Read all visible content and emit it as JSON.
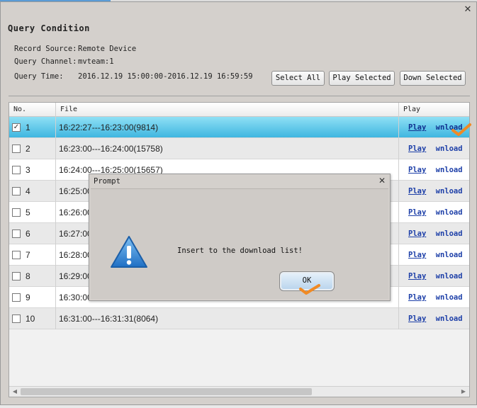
{
  "window": {
    "close_icon": "close-icon"
  },
  "query": {
    "title": "Query Condition",
    "record_source_label": "Record Source:",
    "record_source_value": "Remote Device",
    "channel_label": "Query Channel:",
    "channel_value": "mvteam:1",
    "time_label": "Query Time:",
    "time_value": "2016.12.19 15:00:00-2016.12.19 16:59:59"
  },
  "buttons": {
    "select_all": "Select All",
    "play_selected": "Play Selected",
    "down_selected": "Down Selected"
  },
  "table": {
    "columns": [
      "No.",
      "File",
      "Play"
    ],
    "play_link": "Play",
    "download_link": "Download",
    "rows": [
      {
        "no": "1",
        "file": "16:22:27---16:23:00(9814)",
        "checked": true,
        "selected": true
      },
      {
        "no": "2",
        "file": "16:23:00---16:24:00(15758)",
        "checked": false,
        "selected": false
      },
      {
        "no": "3",
        "file": "16:24:00---16:25:00(15657)",
        "checked": false,
        "selected": false
      },
      {
        "no": "4",
        "file": "16:25:00",
        "checked": false,
        "selected": false
      },
      {
        "no": "5",
        "file": "16:26:00",
        "checked": false,
        "selected": false
      },
      {
        "no": "6",
        "file": "16:27:00",
        "checked": false,
        "selected": false
      },
      {
        "no": "7",
        "file": "16:28:00",
        "checked": false,
        "selected": false
      },
      {
        "no": "8",
        "file": "16:29:00",
        "checked": false,
        "selected": false
      },
      {
        "no": "9",
        "file": "16:30:00",
        "checked": false,
        "selected": false
      },
      {
        "no": "10",
        "file": "16:31:00---16:31:31(8064)",
        "checked": false,
        "selected": false
      }
    ]
  },
  "dialog": {
    "title": "Prompt",
    "message": "Insert to the download list!",
    "ok_label": "OK",
    "icon": "warning-icon"
  },
  "colors": {
    "selected_row": "#3fb6e0",
    "link": "#1d3fa8",
    "annotation_check": "#f08a24",
    "warning_icon": "#2f7fd0"
  }
}
